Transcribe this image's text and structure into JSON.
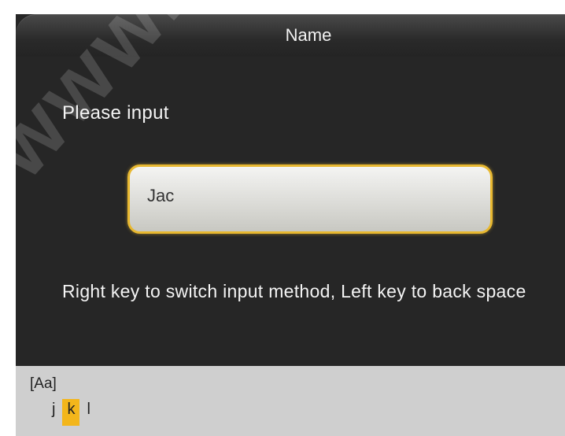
{
  "title_bar": {
    "title": "Name"
  },
  "prompt": {
    "label": "Please input"
  },
  "input": {
    "value": "Jac"
  },
  "hint": {
    "text": "Right key to switch input method, Left key to back space"
  },
  "ime": {
    "mode": "[Aa]",
    "candidates": [
      "j",
      "k",
      "l"
    ],
    "selected_index": 1
  },
  "colors": {
    "accent": "#f3b61b",
    "input_border": "#e8b830",
    "screen_bg": "#262626",
    "ime_bg": "#cfcfcf"
  },
  "watermark": {
    "text": "www.sec"
  }
}
